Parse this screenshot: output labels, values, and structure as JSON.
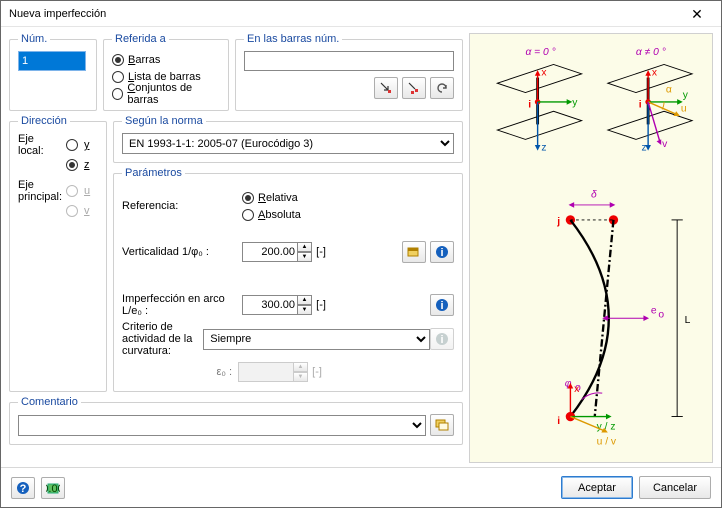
{
  "window": {
    "title": "Nueva imperfección"
  },
  "num": {
    "legend": "Núm.",
    "value": "1"
  },
  "ref": {
    "legend": "Referida a",
    "opts": {
      "barras": "Barras",
      "lista": "Lista de barras",
      "conjuntos": "Conjuntos de barras"
    },
    "selected": "barras"
  },
  "barras": {
    "legend": "En las barras núm.",
    "value": ""
  },
  "dir": {
    "legend": "Dirección",
    "eje_local": "Eje local:",
    "eje_principal": "Eje principal:",
    "y": "y",
    "z": "z",
    "u": "u",
    "v": "v"
  },
  "norma": {
    "legend": "Según la norma",
    "value": "EN 1993-1-1: 2005-07  (Eurocódigo 3)"
  },
  "param": {
    "legend": "Parámetros",
    "referencia": "Referencia:",
    "relativa": "Relativa",
    "absoluta": "Absoluta",
    "vert_label": "Verticalidad 1/φ₀ :",
    "vert_value": "200.00",
    "arc_label": "Imperfección en arco L/e₀ :",
    "arc_value": "300.00",
    "crit_label": "Criterio de actividad de la curvatura:",
    "crit_value": "Siempre",
    "eps_label": "ε₀ :",
    "unit": "[-]"
  },
  "com": {
    "legend": "Comentario",
    "value": ""
  },
  "footer": {
    "ok": "Aceptar",
    "cancel": "Cancelar"
  },
  "diagram": {
    "alpha0": "α = 0 °",
    "alphaN0": "α ≠ 0 °"
  }
}
